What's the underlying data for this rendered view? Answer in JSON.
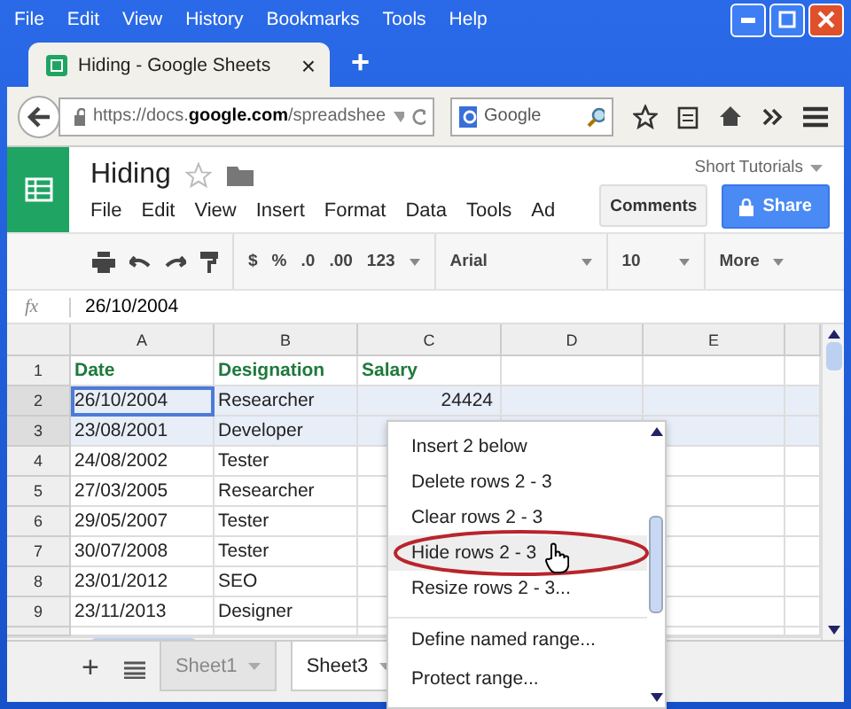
{
  "browser_menu": [
    "File",
    "Edit",
    "View",
    "History",
    "Bookmarks",
    "Tools",
    "Help"
  ],
  "browser_tab": {
    "title": "Hiding - Google Sheets",
    "close": "×",
    "new_tab": "+"
  },
  "address": {
    "url": "https://docs.**google.com**/spreadshee"
  },
  "search": {
    "placeholder": "Google"
  },
  "doc": {
    "title": "Hiding",
    "account": "Short Tutorials",
    "comments": "Comments",
    "share": "Share",
    "menu": [
      "File",
      "Edit",
      "View",
      "Insert",
      "Format",
      "Data",
      "Tools",
      "Ad"
    ]
  },
  "toolbar": {
    "currency": "$",
    "percent": "%",
    "decrease": ".0",
    "increase": ".00",
    "number_format": "123",
    "font": "Arial",
    "size": "10",
    "more": "More"
  },
  "formula_bar": {
    "label": "fx",
    "value": "26/10/2004"
  },
  "columns": [
    "A",
    "B",
    "C",
    "D",
    "E"
  ],
  "rows": [
    {
      "number": "1",
      "kind": "header",
      "selected": false,
      "cells": [
        "Date",
        "Designation",
        "Salary"
      ]
    },
    {
      "number": "2",
      "kind": "data",
      "selected": true,
      "cells": [
        "26/10/2004",
        "Researcher",
        "24424"
      ]
    },
    {
      "number": "3",
      "kind": "data",
      "selected": true,
      "cells": [
        "23/08/2001",
        "Developer",
        ""
      ]
    },
    {
      "number": "4",
      "kind": "data",
      "selected": false,
      "cells": [
        "24/08/2002",
        "Tester",
        ""
      ]
    },
    {
      "number": "5",
      "kind": "data",
      "selected": false,
      "cells": [
        "27/03/2005",
        "Researcher",
        ""
      ]
    },
    {
      "number": "6",
      "kind": "data",
      "selected": false,
      "cells": [
        "29/05/2007",
        "Tester",
        ""
      ]
    },
    {
      "number": "7",
      "kind": "data",
      "selected": false,
      "cells": [
        "30/07/2008",
        "Tester",
        ""
      ]
    },
    {
      "number": "8",
      "kind": "data",
      "selected": false,
      "cells": [
        "23/01/2012",
        "SEO",
        ""
      ]
    },
    {
      "number": "9",
      "kind": "data",
      "selected": false,
      "cells": [
        "23/11/2013",
        "Designer",
        ""
      ]
    }
  ],
  "add_sheet": "+",
  "sheets": [
    {
      "label": "Sheet1",
      "selected": false
    },
    {
      "label": "Sheet3",
      "selected": true
    }
  ],
  "context_menu": [
    {
      "label": "Insert 2 below",
      "selected": false,
      "separator_before": false
    },
    {
      "label": "Delete rows 2 - 3",
      "selected": false,
      "separator_before": false
    },
    {
      "label": "Clear rows 2 - 3",
      "selected": false,
      "separator_before": false
    },
    {
      "label": "Hide rows 2 - 3",
      "selected": true,
      "separator_before": false
    },
    {
      "label": "Resize rows 2 - 3...",
      "selected": false,
      "separator_before": false
    },
    {
      "label": "Define named range...",
      "selected": false,
      "separator_before": true
    },
    {
      "label": "Protect range...",
      "selected": false,
      "separator_before": false
    }
  ]
}
